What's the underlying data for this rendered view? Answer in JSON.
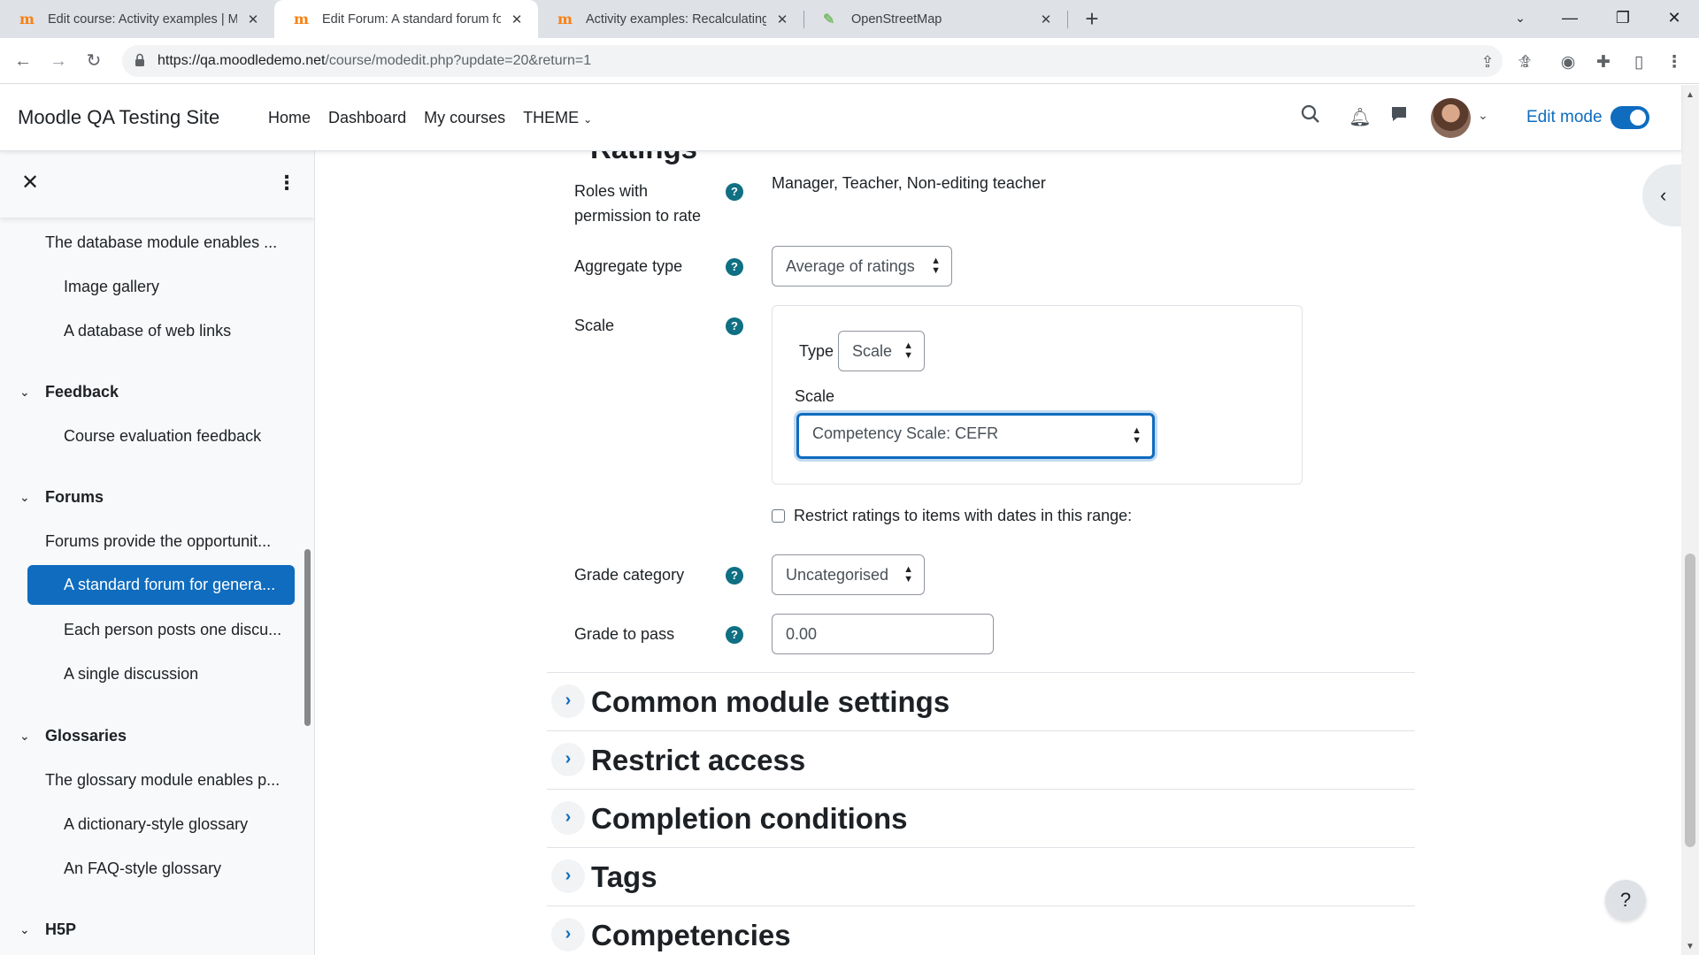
{
  "browser": {
    "tabs": [
      {
        "title": "Edit course: Activity examples | M",
        "active": false,
        "favicon": "moodle-icon"
      },
      {
        "title": "Edit Forum: A standard forum for",
        "active": true,
        "favicon": "moodle-icon"
      },
      {
        "title": "Activity examples: Recalculating",
        "active": false,
        "favicon": "moodle-icon"
      },
      {
        "title": "OpenStreetMap",
        "active": false,
        "favicon": "osm-icon"
      }
    ],
    "url_host": "https://qa.moodledemo.net",
    "url_path": "/course/modedit.php?update=20&return=1"
  },
  "navbar": {
    "site_name": "Moodle QA Testing Site",
    "links": [
      "Home",
      "Dashboard",
      "My courses",
      "THEME"
    ],
    "edit_mode_label": "Edit mode",
    "accent": "#0f6cbf"
  },
  "drawer": {
    "items": [
      {
        "type": "item",
        "label": "The database module enables ...",
        "indent": 0
      },
      {
        "type": "item",
        "label": "Image gallery",
        "indent": 1
      },
      {
        "type": "item",
        "label": "A database of web links",
        "indent": 1
      },
      {
        "type": "section",
        "label": "Feedback"
      },
      {
        "type": "item",
        "label": "Course evaluation feedback",
        "indent": 1
      },
      {
        "type": "section",
        "label": "Forums"
      },
      {
        "type": "item",
        "label": "Forums provide the opportunit...",
        "indent": 0
      },
      {
        "type": "item",
        "label": "A standard forum for genera...",
        "indent": 1,
        "active": true
      },
      {
        "type": "item",
        "label": "Each person posts one discu...",
        "indent": 1
      },
      {
        "type": "item",
        "label": "A single discussion",
        "indent": 1
      },
      {
        "type": "section",
        "label": "Glossaries"
      },
      {
        "type": "item",
        "label": "The glossary module enables p...",
        "indent": 0
      },
      {
        "type": "item",
        "label": "A dictionary-style glossary",
        "indent": 1
      },
      {
        "type": "item",
        "label": "An FAQ-style glossary",
        "indent": 1
      },
      {
        "type": "section",
        "label": "H5P"
      }
    ]
  },
  "form": {
    "partial_heading": "Ratings",
    "roles_label": "Roles with permission to rate",
    "roles_value": "Manager, Teacher, Non-editing teacher",
    "aggregate_label": "Aggregate type",
    "aggregate_value": "Average of ratings",
    "scale_label": "Scale",
    "type_label": "Type",
    "type_value": "Scale",
    "scale_inner_label": "Scale",
    "scale_value": "Competency Scale: CEFR",
    "restrict_label": "Restrict ratings to items with dates in this range:",
    "restrict_checked": false,
    "grade_category_label": "Grade category",
    "grade_category_value": "Uncategorised",
    "grade_to_pass_label": "Grade to pass",
    "grade_to_pass_value": "0.00",
    "help_icon": "?"
  },
  "sections": [
    "Common module settings",
    "Restrict access",
    "Completion conditions",
    "Tags",
    "Competencies"
  ],
  "help_fab": "?"
}
